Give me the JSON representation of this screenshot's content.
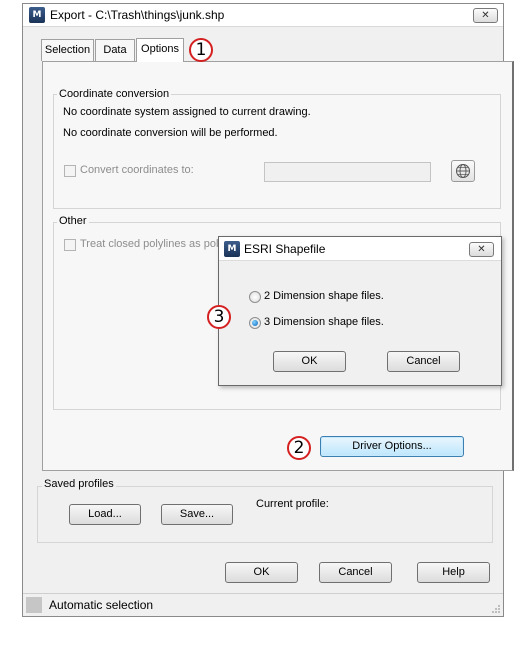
{
  "window": {
    "title": "Export - C:\\Trash\\things\\junk.shp",
    "close_glyph": "✕",
    "app_icon_text": "M"
  },
  "tabs": [
    {
      "label": "Selection",
      "active": false
    },
    {
      "label": "Data",
      "active": false
    },
    {
      "label": "Options",
      "active": true
    }
  ],
  "coordinate_conversion": {
    "group_label": "Coordinate conversion",
    "line1": "No coordinate system assigned to current drawing.",
    "line2": "No coordinate conversion will be performed.",
    "convert_label": "Convert coordinates to:",
    "convert_value": "",
    "globe_icon": "globe-icon"
  },
  "other": {
    "group_label": "Other",
    "polylines_label": "Treat closed polylines as polyg"
  },
  "driver_options_label": "Driver Options...",
  "saved_profiles": {
    "group_label": "Saved profiles",
    "load_label": "Load...",
    "save_label": "Save...",
    "current_profile_label": "Current profile:"
  },
  "buttons": {
    "ok": "OK",
    "cancel": "Cancel",
    "help": "Help"
  },
  "status": {
    "text": "Automatic selection"
  },
  "esri_dialog": {
    "title": "ESRI Shapefile",
    "option_2d": "2 Dimension shape files.",
    "option_3d": "3 Dimension shape files.",
    "selected": "3d",
    "ok": "OK",
    "cancel": "Cancel"
  },
  "callouts": [
    "1",
    "2",
    "3"
  ],
  "colors": {
    "callout_border": "#d42020",
    "focused_button": "#bde6fd"
  }
}
